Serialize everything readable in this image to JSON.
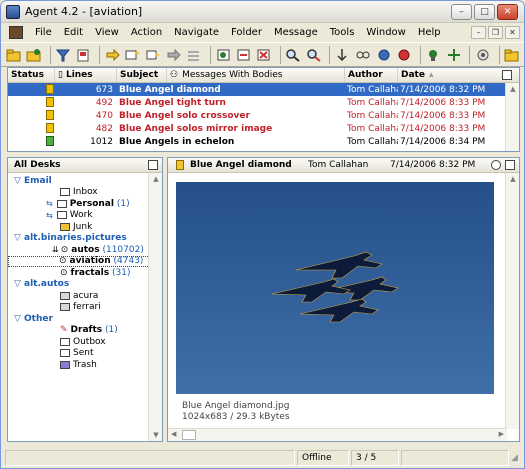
{
  "window": {
    "title": "Agent 4.2 - [aviation]",
    "controls": {
      "minimize": "–",
      "maximize": "□",
      "close": "✕"
    }
  },
  "menu": {
    "items": [
      "File",
      "Edit",
      "View",
      "Action",
      "Navigate",
      "Folder",
      "Message",
      "Tools",
      "Window",
      "Help"
    ],
    "mdi": {
      "minimize": "–",
      "restore": "❐",
      "close": "✕"
    }
  },
  "message_list": {
    "columns": {
      "status": "Status",
      "lines": "Lines",
      "subject": "Subject",
      "filter": "Messages With Bodies",
      "author": "Author",
      "date": "Date"
    },
    "rows": [
      {
        "lines": "673",
        "subject": "Blue Angel diamond",
        "author": "Tom Callaha",
        "date": "7/14/2006 8:32 PM"
      },
      {
        "lines": "492",
        "subject": "Blue Angel tight turn",
        "author": "Tom Callaha",
        "date": "7/14/2006 8:33 PM"
      },
      {
        "lines": "470",
        "subject": "Blue Angel solo crossover",
        "author": "Tom Callaha",
        "date": "7/14/2006 8:33 PM"
      },
      {
        "lines": "482",
        "subject": "Blue Angel solos mirror image",
        "author": "Tom Callaha",
        "date": "7/14/2006 8:33 PM"
      },
      {
        "lines": "1012",
        "subject": "Blue Angels in echelon",
        "author": "Tom Callaha",
        "date": "7/14/2006 8:34 PM"
      }
    ]
  },
  "desks": {
    "header": "All Desks",
    "email": {
      "label": "Email",
      "inbox": "Inbox",
      "personal": "Personal",
      "personal_count": "(1)",
      "work": "Work",
      "junk": "Junk"
    },
    "binaries": {
      "label": "alt.binaries.pictures",
      "autos": "autos",
      "autos_count": "(110702)",
      "aviation": "aviation",
      "aviation_count": "(4743)",
      "fractals": "fractals",
      "fractals_count": "(31)"
    },
    "autos_group": {
      "label": "alt.autos",
      "acura": "acura",
      "ferrari": "ferrari"
    },
    "other": {
      "label": "Other",
      "drafts": "Drafts",
      "drafts_count": "(1)",
      "outbox": "Outbox",
      "sent": "Sent",
      "trash": "Trash"
    }
  },
  "viewer": {
    "subject": "Blue Angel diamond",
    "author": "Tom Callahan",
    "date": "7/14/2006 8:32 PM",
    "caption_file": "Blue Angel diamond.jpg",
    "caption_info": "1024x683 / 29.3 kBytes"
  },
  "status": {
    "connection": "Offline",
    "position": "3 / 5"
  }
}
